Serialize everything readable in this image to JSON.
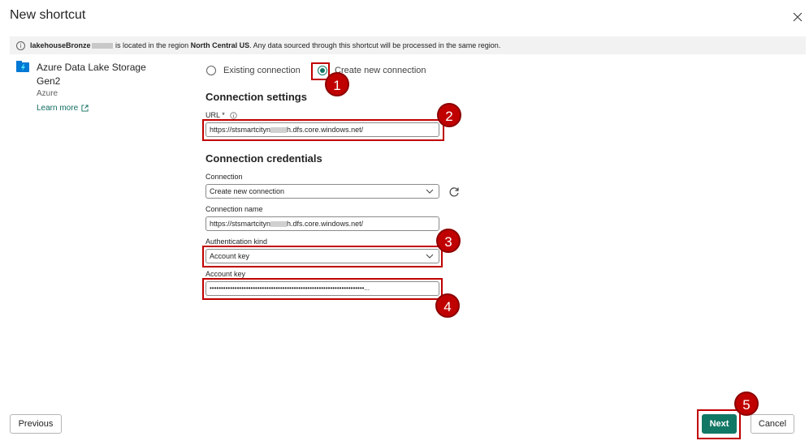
{
  "dialog": {
    "title": "New shortcut"
  },
  "banner": {
    "name_prefix": "lakehouseBronze",
    "text_mid": "is located in the region",
    "region": "North Central US",
    "text_end": ". Any data sourced through this shortcut will be processed in the same region."
  },
  "source": {
    "name": "Azure Data Lake Storage Gen2",
    "category": "Azure",
    "learn_more": "Learn more"
  },
  "connection_choice": {
    "existing_label": "Existing connection",
    "new_label": "Create new connection",
    "selected": "new"
  },
  "connection_settings": {
    "heading": "Connection settings",
    "url_label": "URL",
    "url_required_mark": "*",
    "url_prefix": "https://stsmartcityn",
    "url_suffix": "h.dfs.core.windows.net/"
  },
  "credentials": {
    "heading": "Connection credentials",
    "connection_label": "Connection",
    "connection_value": "Create new connection",
    "connection_name_label": "Connection name",
    "connection_name_prefix": "https://stsmartcityn",
    "connection_name_suffix": "h.dfs.core.windows.net/",
    "auth_kind_label": "Authentication kind",
    "auth_kind_value": "Account key",
    "account_key_label": "Account key",
    "account_key_value": "••••••••••••••••••••••••••••••••••••••••••••••••••••••••••••••••••••..."
  },
  "annotations": [
    "1",
    "2",
    "3",
    "4",
    "5"
  ],
  "footer": {
    "previous": "Previous",
    "next": "Next",
    "cancel": "Cancel"
  },
  "colors": {
    "accent": "#117865",
    "highlight": "#c00000",
    "banner_bg": "#f2f2f2"
  },
  "icons": [
    "info-icon",
    "close-icon",
    "storage-icon",
    "external-link-icon",
    "info-circle-icon",
    "chevron-down-icon",
    "refresh-icon"
  ]
}
